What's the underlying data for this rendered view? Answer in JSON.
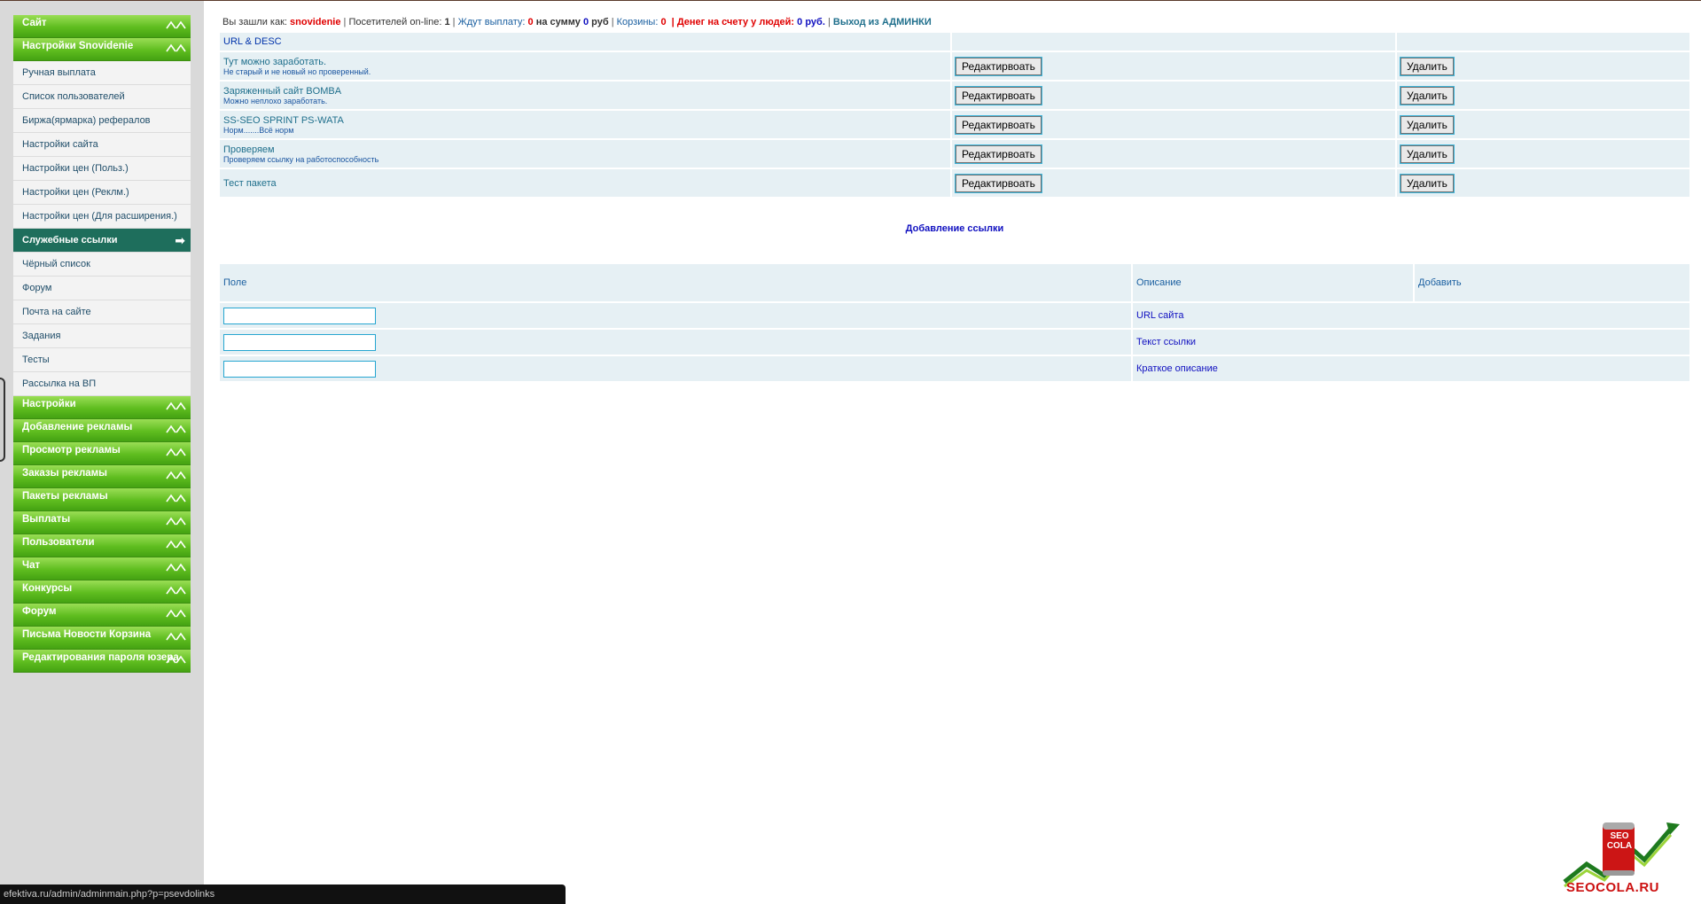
{
  "sidebar": {
    "top_categories": [
      "Сайт",
      "Настройки Snovidenie"
    ],
    "sub_items": [
      {
        "label": "Ручная выплата"
      },
      {
        "label": "Список пользователей"
      },
      {
        "label": "Биржа(ярмарка) рефералов"
      },
      {
        "label": "Настройки сайта"
      },
      {
        "label": "Настройки цен (Польз.)"
      },
      {
        "label": "Настройки цен (Реклм.)"
      },
      {
        "label": "Настройки цен (Для расширения.)"
      },
      {
        "label": "Служебные ссылки",
        "active": true,
        "arrow": "➡"
      },
      {
        "label": "Чёрный список"
      },
      {
        "label": "Форум"
      },
      {
        "label": "Почта на сайте"
      },
      {
        "label": "Задания"
      },
      {
        "label": "Тесты"
      },
      {
        "label": "Рассылка на ВП"
      }
    ],
    "bottom_categories": [
      "Настройки",
      "Добавление рекламы",
      "Просмотр рекламы",
      "Заказы рекламы",
      "Пакеты рекламы",
      "Выплаты",
      "Пользователи",
      "Чат",
      "Конкурсы",
      "Форум",
      "Письма Новости Корзина",
      "Редактирования пароля юзера"
    ]
  },
  "status": {
    "logged_as_label": "Вы зашли как:",
    "username": "snovidenie",
    "online_label": "Посетителей on-line:",
    "online_count": "1",
    "awaiting_label": "Ждут выплату:",
    "awaiting_count": "0",
    "sum_label": "на сумму",
    "sum_value": "0",
    "sum_currency": "руб",
    "carts_label": "Корзины:",
    "carts_count": "0",
    "money_label": "Денег на счету у людей:",
    "money_value": "0 руб.",
    "logout_label": "Выход из АДМИНКИ"
  },
  "links_table": {
    "header": "URL & DESC",
    "edit_label": "Редактирвоать",
    "delete_label": "Удалить",
    "rows": [
      {
        "title": "Тут можно заработать.",
        "desc": "Не старый и не новый но проверенный."
      },
      {
        "title": "Заряженный сайт BOMBA",
        "desc": "Можно неплохо заработать."
      },
      {
        "title": "SS-SEO SPRINT PS-WATA",
        "desc": "Норм.......Всё норм"
      },
      {
        "title": "Проверяем",
        "desc": "Проверяем ссылку на работоспособность"
      },
      {
        "title": "Тест пакета",
        "desc": ""
      }
    ]
  },
  "add_form": {
    "title": "Добавление ссылки",
    "col_field": "Поле",
    "col_desc": "Описание",
    "col_add": "Добавить",
    "fields": [
      {
        "label": "URL сайта",
        "value": ""
      },
      {
        "label": "Текст ссылки",
        "value": ""
      },
      {
        "label": "Краткое описание",
        "value": ""
      }
    ]
  },
  "statusbar_url": "efektiva.ru/admin/adminmain.php?p=psevdolinks",
  "logo": {
    "can_text": "SEO COLA",
    "site": "SEOCOLA.RU"
  },
  "colors": {
    "menu_green": "#5fbd1f",
    "active_item": "#1e6e5c",
    "status_red": "#e00000",
    "table_bg": "#e6f0f4"
  }
}
